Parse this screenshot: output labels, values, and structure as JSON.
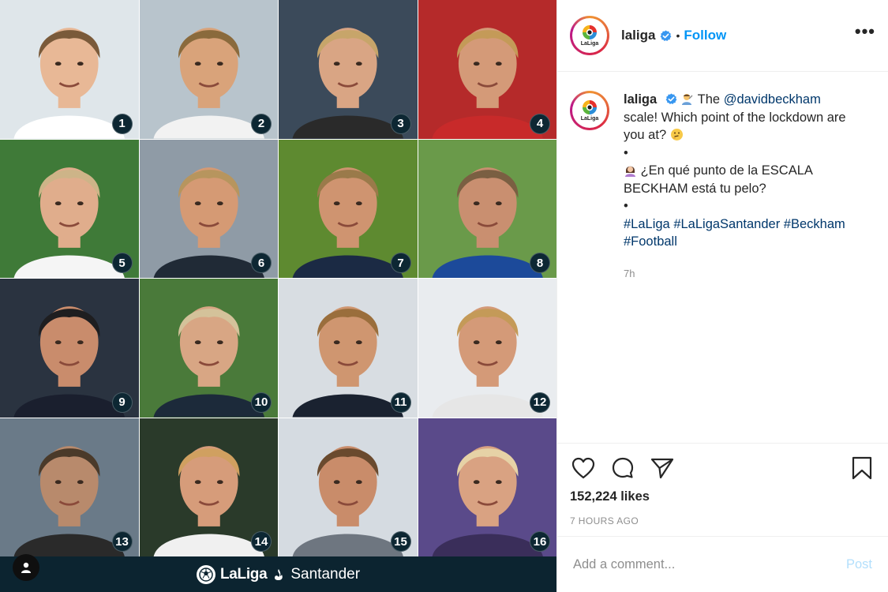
{
  "post": {
    "username": "laliga",
    "follow_label": "Follow",
    "more_label": "•••",
    "caption": {
      "line1_text": "The",
      "mention": "@davidbeckham",
      "line1_rest": "scale! Which point of the lockdown are you at?",
      "bullet": "•",
      "spanish_text": "¿En qué punto de la ESCALA BECKHAM está tu pelo?",
      "hashtags": [
        "#LaLiga",
        "#LaLigaSantander",
        "#Beckham",
        "#Football"
      ]
    },
    "time_ago": "7h",
    "likes": "152,224 likes",
    "posted_ago": "7 HOURS AGO",
    "comment_placeholder": "Add a comment...",
    "post_label": "Post"
  },
  "avatar_text": "LaLiga",
  "media": {
    "brand_bold": "LaLiga",
    "brand_light": "Santander",
    "tiles": [
      {
        "n": "1",
        "bg": "#dfe6ea",
        "hair": "#7a5a3a",
        "skin": "#e8b896",
        "shirt": "#ffffff"
      },
      {
        "n": "2",
        "bg": "#b8c4cc",
        "hair": "#8a6a3c",
        "skin": "#d9a37a",
        "shirt": "#f2f2f2"
      },
      {
        "n": "3",
        "bg": "#3b4a5a",
        "hair": "#c7a56a",
        "skin": "#d9a584",
        "shirt": "#2a2a2a"
      },
      {
        "n": "4",
        "bg": "#b52a2a",
        "hair": "#c49a58",
        "skin": "#d49a78",
        "shirt": "#c82a2a"
      },
      {
        "n": "5",
        "bg": "#3f7a38",
        "hair": "#cdb488",
        "skin": "#e0ad8c",
        "shirt": "#f5f5f5"
      },
      {
        "n": "6",
        "bg": "#8f9ba6",
        "hair": "#b7955e",
        "skin": "#d59a74",
        "shirt": "#202a36"
      },
      {
        "n": "7",
        "bg": "#5e8a30",
        "hair": "#9a7a4a",
        "skin": "#cf9470",
        "shirt": "#1b2a44"
      },
      {
        "n": "8",
        "bg": "#6a9a4a",
        "hair": "#7a5f42",
        "skin": "#c98f70",
        "shirt": "#1c4a9a"
      },
      {
        "n": "9",
        "bg": "#2a3340",
        "hair": "#1e1e20",
        "skin": "#c98c6c",
        "shirt": "#1a1f2e"
      },
      {
        "n": "10",
        "bg": "#4a7a3a",
        "hair": "#d4c29a",
        "skin": "#d8a684",
        "shirt": "#1c2a3a"
      },
      {
        "n": "11",
        "bg": "#d8dde2",
        "hair": "#9a6e3c",
        "skin": "#cf9670",
        "shirt": "#1a2230"
      },
      {
        "n": "12",
        "bg": "#e9ecef",
        "hair": "#c49a58",
        "skin": "#d49a78",
        "shirt": "#e6e6e6"
      },
      {
        "n": "13",
        "bg": "#6a7a88",
        "hair": "#4a3a2a",
        "skin": "#b88a6c",
        "shirt": "#2a2a2a"
      },
      {
        "n": "14",
        "bg": "#2a3a2a",
        "hair": "#d0a060",
        "skin": "#d69c7a",
        "shirt": "#f0f0f0"
      },
      {
        "n": "15",
        "bg": "#d5dbe1",
        "hair": "#6a4a2e",
        "skin": "#c98c6a",
        "shirt": "#6e7680"
      },
      {
        "n": "16",
        "bg": "#5a4a8a",
        "hair": "#e6d2a6",
        "skin": "#d9a282",
        "shirt": "#3a2e5a"
      }
    ]
  },
  "colors": {
    "follow": "#0095f6",
    "link": "#00376b",
    "verified": "#3897f0",
    "brand_bar": "#0c2430"
  },
  "icons": [
    "verified-badge-icon",
    "more-options-icon",
    "like-heart-icon",
    "comment-bubble-icon",
    "share-plane-icon",
    "bookmark-icon",
    "user-tag-icon"
  ]
}
